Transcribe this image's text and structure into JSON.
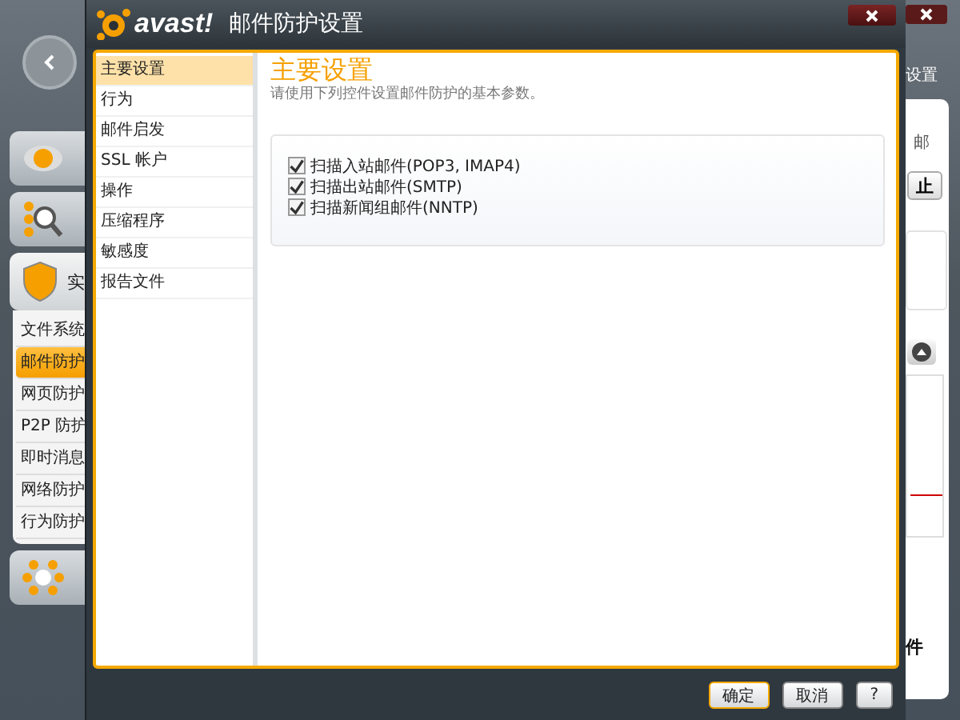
{
  "background_app": {
    "nav": [
      {
        "kind": "eye"
      },
      {
        "kind": "scan"
      },
      {
        "label": "实",
        "kind": "shield"
      },
      {
        "kind": "network"
      }
    ],
    "submenu": [
      {
        "label": "文件系统",
        "selected": false
      },
      {
        "label": "邮件防护",
        "selected": true
      },
      {
        "label": "网页防护",
        "selected": false
      },
      {
        "label": "P2P 防护",
        "selected": false
      },
      {
        "label": "即时消息",
        "selected": false
      },
      {
        "label": "网络防护",
        "selected": false
      },
      {
        "label": "行为防护",
        "selected": false
      }
    ],
    "header_text": "设置",
    "panel_text": "邮",
    "button_text": "止",
    "footer_text": "件"
  },
  "dialog": {
    "brand": "avast!",
    "title": "邮件防护设置",
    "sections": [
      {
        "label": "主要设置",
        "selected": true
      },
      {
        "label": "行为",
        "selected": false
      },
      {
        "label": "邮件启发",
        "selected": false
      },
      {
        "label": "SSL 帐户",
        "selected": false
      },
      {
        "label": "操作",
        "selected": false
      },
      {
        "label": "压缩程序",
        "selected": false
      },
      {
        "label": "敏感度",
        "selected": false
      },
      {
        "label": "报告文件",
        "selected": false
      }
    ],
    "heading": "主要设置",
    "description": "请使用下列控件设置邮件防护的基本参数。",
    "options": [
      {
        "label": "扫描入站邮件(POP3, IMAP4)",
        "checked": true
      },
      {
        "label": "扫描出站邮件(SMTP)",
        "checked": true
      },
      {
        "label": "扫描新闻组邮件(NNTP)",
        "checked": true
      }
    ],
    "buttons": [
      {
        "label": "确定",
        "kind": "default"
      },
      {
        "label": "取消",
        "kind": "normal"
      },
      {
        "label": "?",
        "kind": "normal"
      }
    ]
  }
}
